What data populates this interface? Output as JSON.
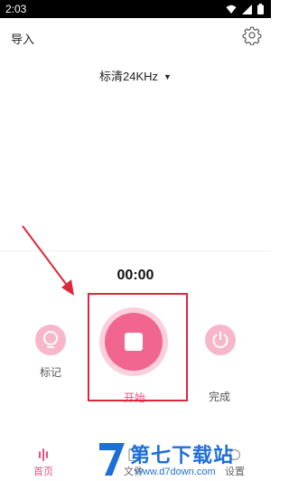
{
  "status_bar": {
    "time": "2:03"
  },
  "header": {
    "import_label": "导入"
  },
  "quality": {
    "label": "标清24KHz"
  },
  "recorder": {
    "timer": "00:00",
    "mark_label": "标记",
    "start_label": "开始",
    "done_label": "完成"
  },
  "tabs": [
    {
      "label": "首页",
      "active": true
    },
    {
      "label": "文件",
      "active": false
    },
    {
      "label": "设置",
      "active": false
    }
  ],
  "watermark": {
    "text": "第七下载站",
    "url": "www.d7down.com"
  },
  "colors": {
    "accent": "#ef4f82",
    "accent_light": "#f7b6c9",
    "annotation": "#e0263a",
    "watermark": "#1d6fd8"
  }
}
